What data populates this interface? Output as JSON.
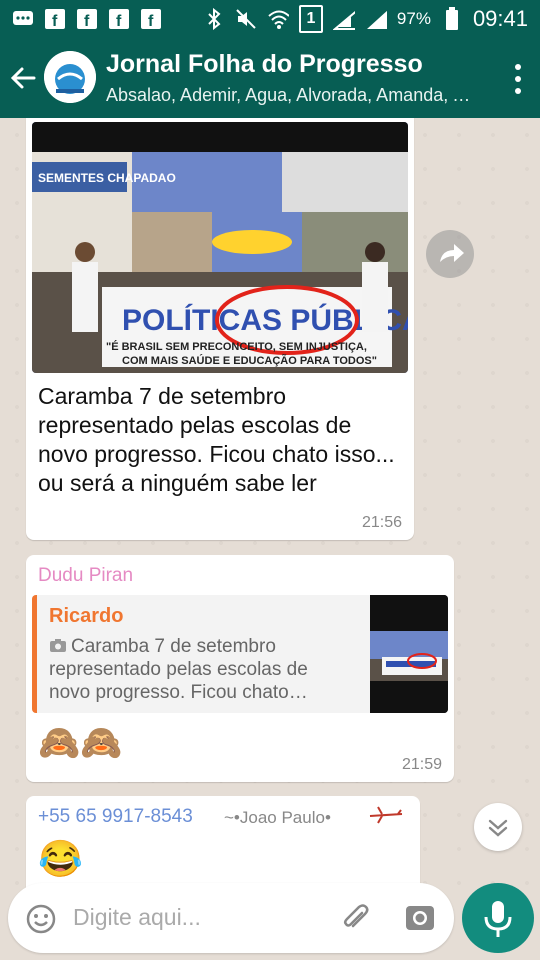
{
  "statusbar": {
    "left_icons": [
      "chat-icon",
      "facebook-icon",
      "facebook-icon",
      "facebook-icon",
      "facebook-icon"
    ],
    "battery": "97%",
    "clock": "09:41",
    "sim_label": "1"
  },
  "appbar": {
    "title": "Jornal Folha do Progresso",
    "subtitle": "Absalao, Ademir, Agua, Alvorada, Amanda, Ana",
    "accent": "#075e54"
  },
  "messages": [
    {
      "type": "image",
      "image_banner_top": "SEMENTES CHAPADAO",
      "image_banner_main": "POLÍTICAS PÚBLICAS",
      "image_banner_sub1": "\"É BRASIL SEM PRECONCEITO, SEM INJUSTIÇA,",
      "image_banner_sub2": "COM MAIS SAÚDE E EDUCAÇÃO PARA TODOS\"",
      "caption": "Caramba 7 de setembro representado pelas escolas de novo progresso. Ficou chato isso... ou será a ninguém sabe ler",
      "time": "21:56"
    },
    {
      "type": "reply",
      "sender": "Dudu Piran",
      "sender_color": "#e58ac3",
      "quoted_name": "Ricardo",
      "quoted_text": "Caramba 7 de setembro representado pelas escolas de novo progresso. Ficou chato…",
      "emoji": "🙈🙈",
      "time": "21:59"
    },
    {
      "type": "text",
      "phone": "+55 65 9917-8543",
      "name": "~•Joao Paulo•",
      "emoji": "😂"
    }
  ],
  "input": {
    "placeholder": "Digite aqui..."
  }
}
